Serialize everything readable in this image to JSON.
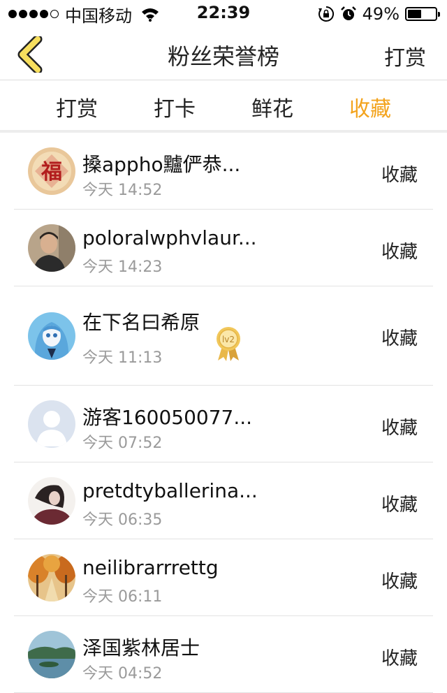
{
  "status_bar": {
    "carrier": "中国移动",
    "time": "22:39",
    "battery": "49%",
    "battery_level": 0.49,
    "icons": [
      "signal-dots-icon",
      "wifi-icon",
      "orientation-lock-icon",
      "alarm-icon",
      "battery-icon"
    ]
  },
  "navbar": {
    "back_icon": "chevron-left-icon",
    "title": "粉丝荣誉榜",
    "action": "打赏"
  },
  "tabs": [
    {
      "label": "打赏",
      "active": false
    },
    {
      "label": "打卡",
      "active": false
    },
    {
      "label": "鲜花",
      "active": false
    },
    {
      "label": "收藏",
      "active": true
    }
  ],
  "colors": {
    "accent": "#f3a31c",
    "back_icon_fill": "#f7df5e",
    "divider": "#e2e2e2"
  },
  "fans": [
    {
      "name": "搡appho黸俨恭...",
      "time": "今天 14:52",
      "action": "收藏",
      "avatar": "fu-character-avatar"
    },
    {
      "name": "poloralwphvlaur...",
      "time": "今天 14:23",
      "action": "收藏",
      "avatar": "man-photo-avatar"
    },
    {
      "name": "在下名曰希原",
      "time": "今天 11:13",
      "action": "收藏",
      "avatar": "anime-girl-avatar",
      "badge": "lv2",
      "badge_icon": "level-medal-icon"
    },
    {
      "name": "游客160050077...",
      "time": "今天 07:52",
      "action": "收藏",
      "avatar": "default-user-avatar"
    },
    {
      "name": "pretdtyballerina...",
      "time": "今天 06:35",
      "action": "收藏",
      "avatar": "girl-photo-avatar"
    },
    {
      "name": "neilibrarrrettg",
      "time": "今天 06:11",
      "action": "收藏",
      "avatar": "autumn-trees-avatar"
    },
    {
      "name": "泽国紫林居士",
      "time": "今天 04:52",
      "action": "收藏",
      "avatar": "landscape-avatar"
    }
  ]
}
